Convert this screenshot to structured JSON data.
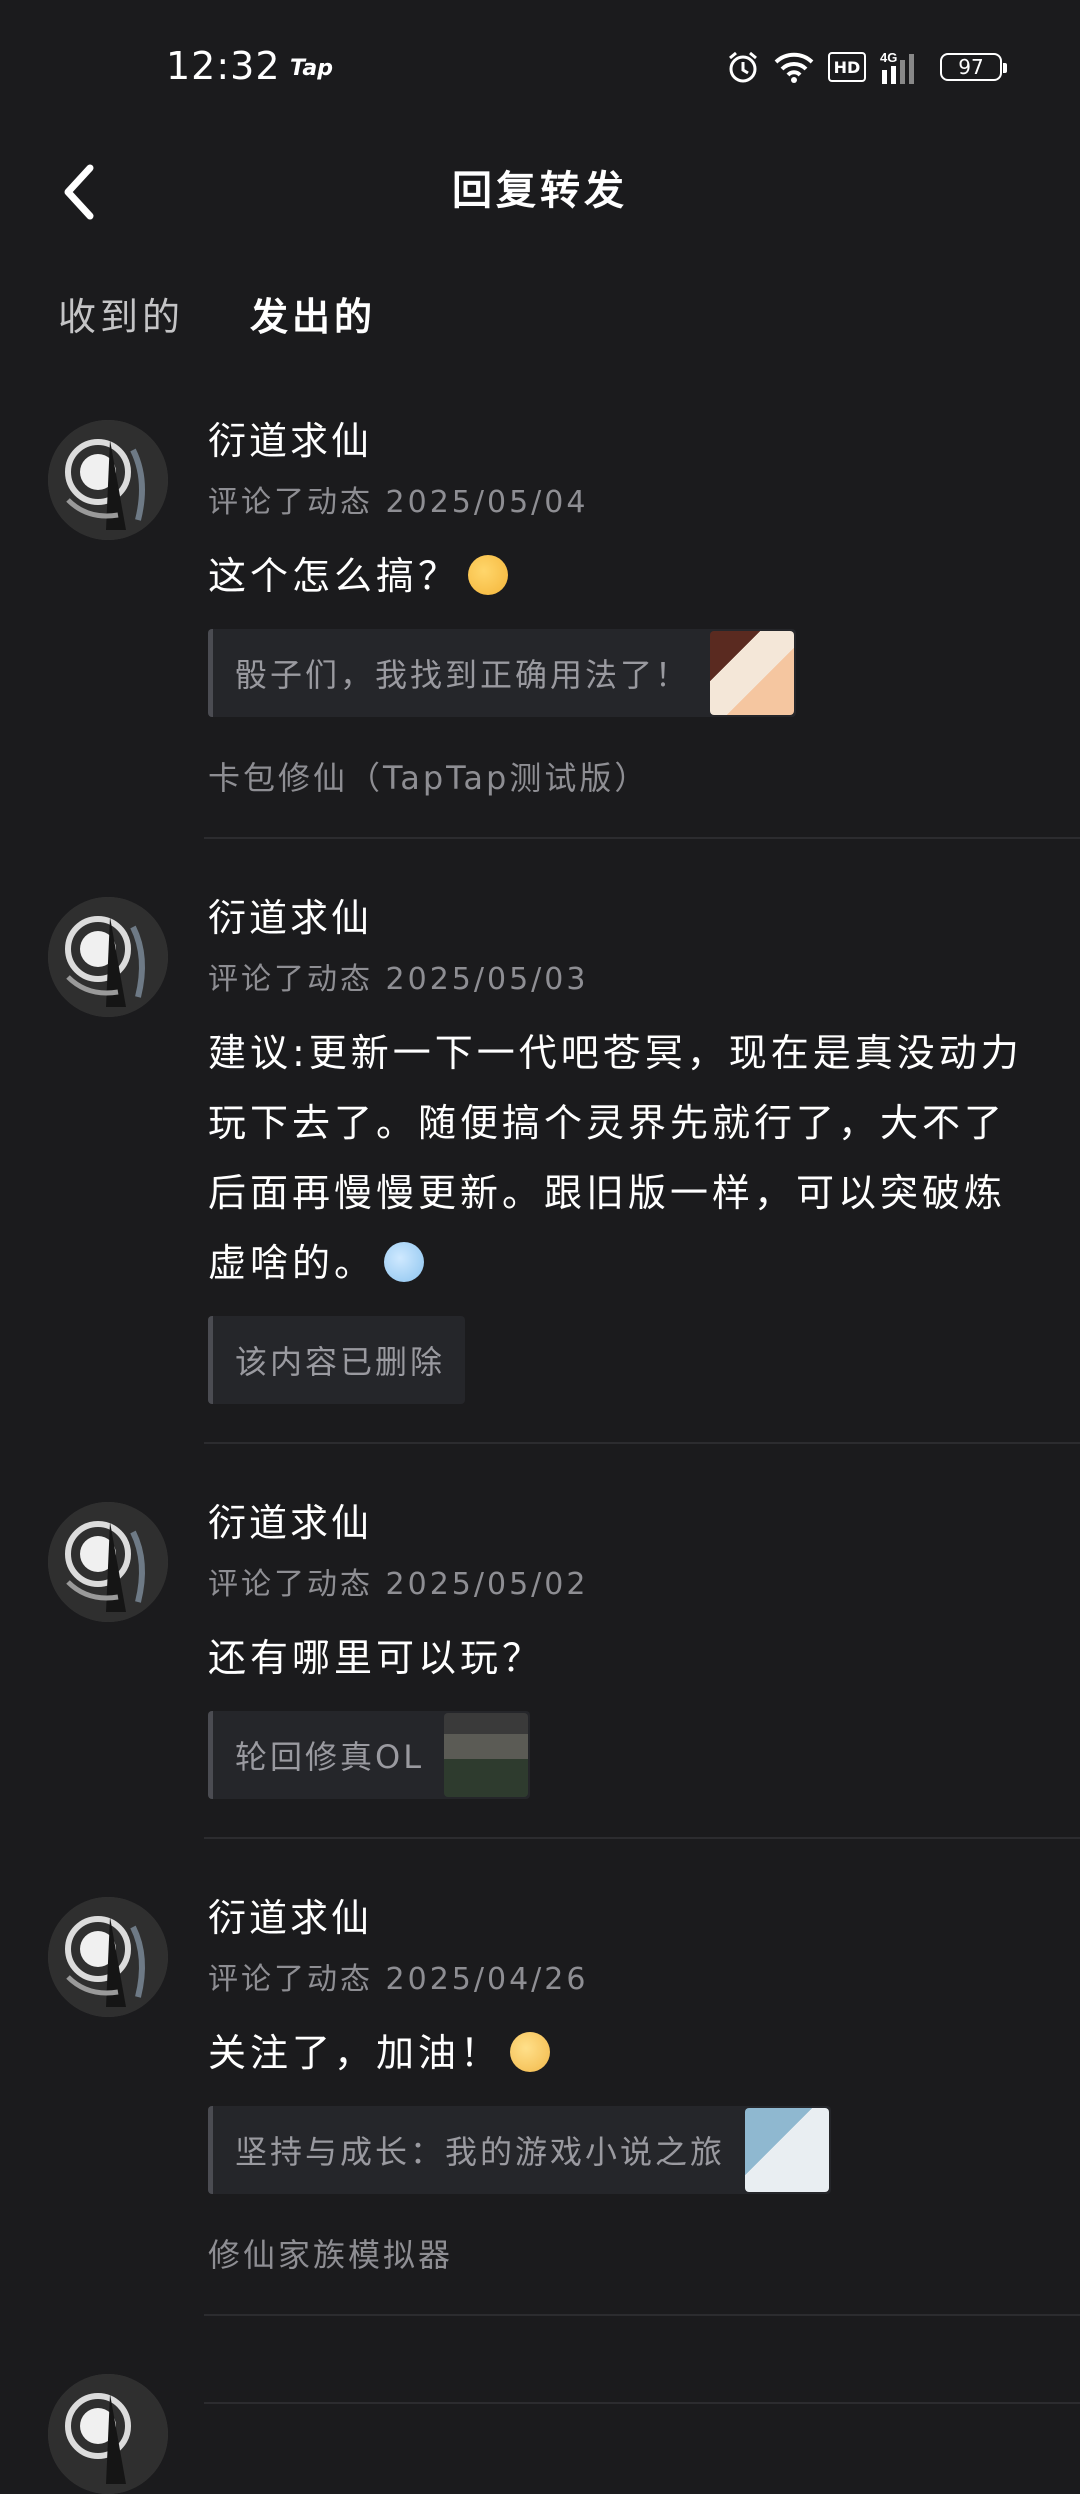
{
  "status_bar": {
    "time": "12:32",
    "app_label": "Tap",
    "network": "4G",
    "hd": "HD",
    "battery": "97",
    "icons": [
      "alarm-icon",
      "wifi-icon",
      "hd-icon",
      "signal-icon",
      "battery-icon"
    ]
  },
  "header": {
    "title": "回复转发",
    "back_icon": "chevron-left-icon"
  },
  "tabs": [
    {
      "label": "收到的",
      "active": false
    },
    {
      "label": "发出的",
      "active": true
    }
  ],
  "colors": {
    "background": "#1b1b1d",
    "accent": "#17c7a8",
    "muted_text": "#8e8e93",
    "quote_bg": "#25262a"
  },
  "items": [
    {
      "user": "衍道求仙",
      "meta": "评论了动态 2025/05/04",
      "comment": "这个怎么搞？",
      "emoji": "thinking-face-emoji",
      "quote": "骰子们，我找到正确用法了！",
      "has_thumb": true,
      "game": "卡包修仙（TapTap测试版）"
    },
    {
      "user": "衍道求仙",
      "meta": "评论了动态 2025/05/03",
      "comment": "建议:更新一下一代吧苍冥，现在是真没动力玩下去了。随便搞个灵界先就行了，大不了后面再慢慢更新。跟旧版一样，可以突破炼虚啥的。",
      "emoji": "cold-face-emoji",
      "quote": "该内容已删除",
      "has_thumb": false,
      "game": ""
    },
    {
      "user": "衍道求仙",
      "meta": "评论了动态 2025/05/02",
      "comment": "还有哪里可以玩？",
      "emoji": "",
      "quote": "轮回修真OL",
      "has_thumb": true,
      "game": ""
    },
    {
      "user": "衍道求仙",
      "meta": "评论了动态 2025/04/26",
      "comment": "关注了，加油！",
      "emoji": "smiling-face-emoji",
      "quote": "坚持与成长：我的游戏小说之旅",
      "has_thumb": true,
      "game": "修仙家族模拟器"
    }
  ]
}
